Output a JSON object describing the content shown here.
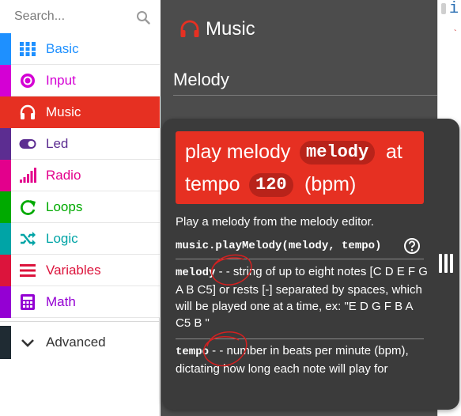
{
  "search": {
    "placeholder": "Search..."
  },
  "categories": [
    {
      "label": "Basic",
      "icon": "grid-icon",
      "color": "#1e90ff"
    },
    {
      "label": "Input",
      "icon": "radio-target-icon",
      "color": "#d400d4"
    },
    {
      "label": "Music",
      "icon": "headphones-icon",
      "color": "#e63022",
      "selected": true
    },
    {
      "label": "Led",
      "icon": "toggle-icon",
      "color": "#5c2d91"
    },
    {
      "label": "Radio",
      "icon": "signal-bars-icon",
      "color": "#e3008c"
    },
    {
      "label": "Loops",
      "icon": "loop-arrow-icon",
      "color": "#00aa00"
    },
    {
      "label": "Logic",
      "icon": "shuffle-icon",
      "color": "#00a4a6"
    },
    {
      "label": "Variables",
      "icon": "list-icon",
      "color": "#dc143c"
    },
    {
      "label": "Math",
      "icon": "calculator-icon",
      "color": "#9400d3"
    }
  ],
  "advanced": {
    "label": "Advanced",
    "icon": "chevron-down-icon"
  },
  "flyout": {
    "title": "Music",
    "section": "Melody"
  },
  "editor": {
    "visible_char": "i",
    "marker": "`"
  },
  "tooltip": {
    "block_line1_prefix": "play melody",
    "block_param1": "melody",
    "block_line1_suffix": "at",
    "block_line2_prefix": "tempo",
    "block_param2": "120",
    "block_line2_suffix": "(bpm)",
    "description": "Play a melody from the melody editor.",
    "signature": "music.playMelody(melody, tempo)",
    "params": [
      {
        "name": "melody",
        "dash": " - - ",
        "text": "string of up to eight notes [C D E F G A B C5] or rests [-] separated by spaces, which will be played one at a time, ex: \"E D G F B A C5 B \""
      },
      {
        "name": "tempo",
        "dash": " - - ",
        "text": "number in beats per minute (bpm), dictating how long each note will play for"
      }
    ]
  },
  "colors": {
    "music_red": "#e63022",
    "flyout_bg": "#4c4c4c",
    "tooltip_bg": "#3b3b3b",
    "annotation_red": "#d42020"
  }
}
